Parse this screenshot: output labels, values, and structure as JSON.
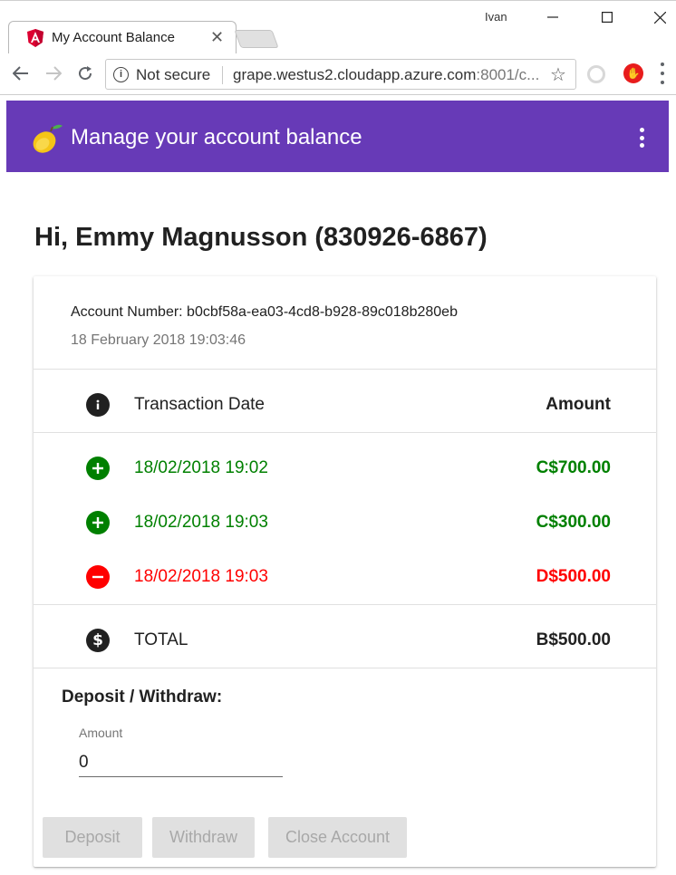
{
  "browser": {
    "tab_title": "My Account Balance",
    "tab_close": "✕",
    "profile_name": "Ivan",
    "security_label": "Not secure",
    "url_host": "grape.westus2.cloudapp.azure.com",
    "url_rest": ":8001/c...",
    "icons": [
      "angular-favicon",
      "back-icon",
      "forward-icon",
      "reload-icon",
      "info-icon",
      "star-icon",
      "extension-icon",
      "adblock-icon",
      "menu-icon"
    ]
  },
  "app": {
    "title": "Manage your account balance",
    "header_color": "#673ab7"
  },
  "greeting": "Hi, Emmy Magnusson (830926-6867)",
  "account": {
    "number": "Account Number: b0cbf58a-ea03-4cd8-b928-89c018b280eb",
    "date": "18 February 2018 19:03:46"
  },
  "table": {
    "header_date": "Transaction Date",
    "header_amount": "Amount",
    "transactions": [
      {
        "type": "deposit",
        "date": "18/02/2018 19:02",
        "amount": "C$700.00",
        "color": "#008000"
      },
      {
        "type": "deposit",
        "date": "18/02/2018 19:03",
        "amount": "C$300.00",
        "color": "#008000"
      },
      {
        "type": "withdraw",
        "date": "18/02/2018 19:03",
        "amount": "D$500.00",
        "color": "#ff0000"
      }
    ],
    "total_label": "TOTAL",
    "total_amount": "B$500.00"
  },
  "form": {
    "title": "Deposit / Withdraw:",
    "amount_label": "Amount",
    "amount_value": "0",
    "deposit_label": "Deposit",
    "withdraw_label": "Withdraw",
    "close_label": "Close Account"
  }
}
